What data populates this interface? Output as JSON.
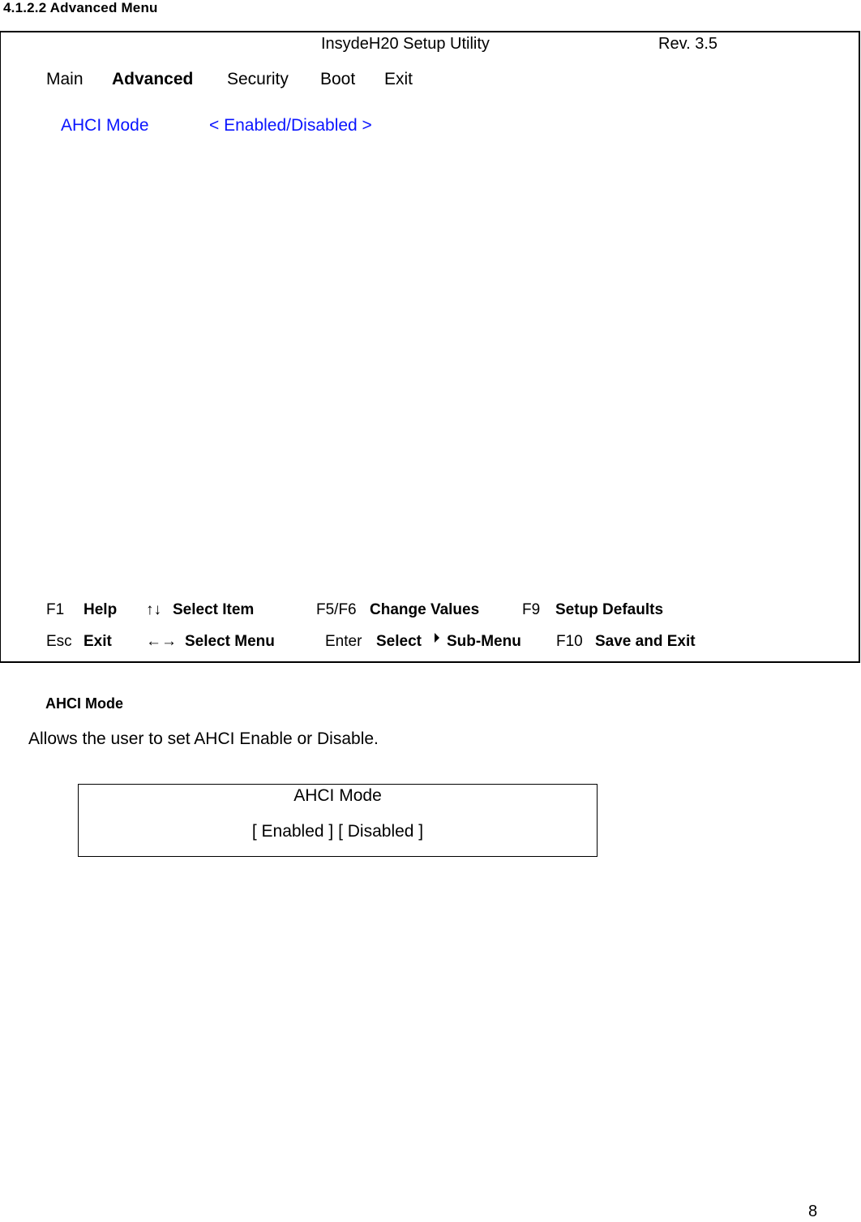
{
  "document": {
    "section_heading": "4.1.2.2  Advanced Menu",
    "page_number": "8"
  },
  "bios": {
    "title": "InsydeH20 Setup Utility",
    "revision": "Rev. 3.5",
    "menu_tabs": [
      {
        "label": "Main",
        "active": false
      },
      {
        "label": "Advanced",
        "active": true
      },
      {
        "label": "Security",
        "active": false
      },
      {
        "label": "Boot",
        "active": false
      },
      {
        "label": "Exit",
        "active": false
      }
    ],
    "settings": [
      {
        "label": "AHCI Mode",
        "value": "< Enabled/Disabled >"
      }
    ],
    "setting_color": "#0a14ff",
    "help_rows": [
      [
        {
          "key": "F1",
          "action": "Help"
        },
        {
          "key": "↑↓",
          "action": "Select Item"
        },
        {
          "key": "F5/F6",
          "action": "Change Values"
        },
        {
          "key": "F9",
          "action": "Setup Defaults"
        }
      ],
      [
        {
          "key": "Esc",
          "action": "Exit"
        },
        {
          "key": "←→",
          "action": "Select Menu"
        },
        {
          "key": "Enter",
          "action": "Select",
          "icon": "right-triangle-icon",
          "action_suffix": "Sub-Menu"
        },
        {
          "key": "F10",
          "action": "Save and Exit"
        }
      ]
    ]
  },
  "description": {
    "heading": "AHCI Mode",
    "text": "Allows the user to set AHCI Enable or Disable.",
    "options_box": {
      "title": "AHCI Mode",
      "values": "[ Enabled ]  [ Disabled ]"
    }
  }
}
